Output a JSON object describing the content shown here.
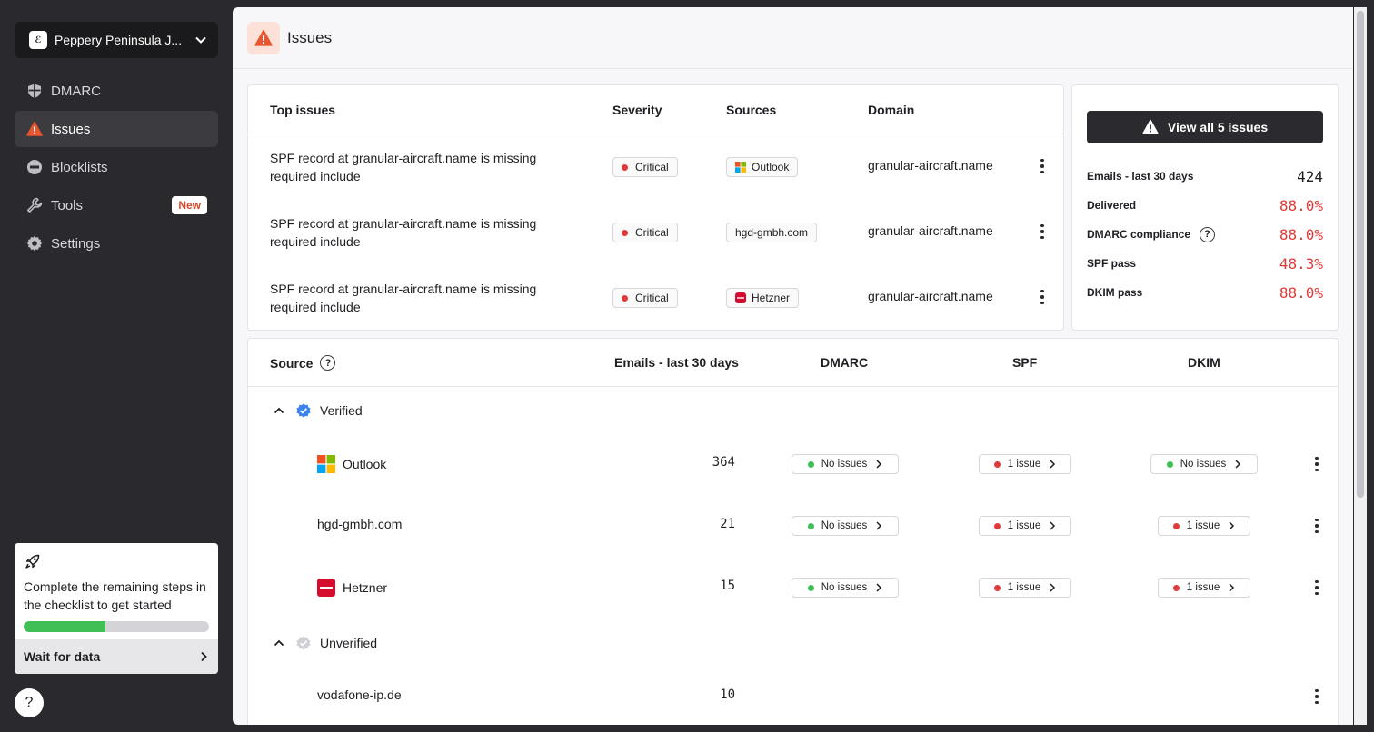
{
  "sidebar": {
    "org_name": "Peppery Peninsula J...",
    "nav": [
      {
        "label": "DMARC",
        "icon": "shield-icon"
      },
      {
        "label": "Issues",
        "icon": "warning-icon"
      },
      {
        "label": "Blocklists",
        "icon": "blocklist-icon"
      },
      {
        "label": "Tools",
        "icon": "wrench-icon",
        "badge": "New"
      },
      {
        "label": "Settings",
        "icon": "gear-icon"
      }
    ],
    "checklist": {
      "text": "Complete the remaining steps in the checklist to get started",
      "progress": 0.44,
      "action": "Wait for data"
    },
    "help": "?"
  },
  "header": {
    "title": "Issues"
  },
  "top_issues": {
    "columns": [
      "Top issues",
      "Severity",
      "Sources",
      "Domain"
    ],
    "rows": [
      {
        "title": "SPF record at granular-aircraft.name is missing required include",
        "severity": "Critical",
        "source": "Outlook",
        "source_icon": "outlook-icon",
        "domain": "granular-aircraft.name"
      },
      {
        "title": "SPF record at granular-aircraft.name is missing required include",
        "severity": "Critical",
        "source": "hgd-gmbh.com",
        "source_icon": "",
        "domain": "granular-aircraft.name"
      },
      {
        "title": "SPF record at granular-aircraft.name is missing required include",
        "severity": "Critical",
        "source": "Hetzner",
        "source_icon": "hetzner-icon",
        "domain": "granular-aircraft.name"
      }
    ]
  },
  "stats": {
    "view_all": "View all 5 issues",
    "items": [
      {
        "label": "Emails - last 30 days",
        "value": "424"
      },
      {
        "label": "Delivered",
        "value": "88.0%"
      },
      {
        "label": "DMARC compliance",
        "value": "88.0%",
        "help": "?"
      },
      {
        "label": "SPF pass",
        "value": "48.3%"
      },
      {
        "label": "DKIM pass",
        "value": "88.0%"
      }
    ]
  },
  "sources": {
    "columns": {
      "source": "Source",
      "emails": "Emails - last 30 days",
      "dmarc": "DMARC",
      "spf": "SPF",
      "dkim": "DKIM"
    },
    "source_help": "?",
    "groups": [
      {
        "label": "Verified"
      },
      {
        "label": "Unverified"
      }
    ],
    "rows": [
      {
        "name": "Outlook",
        "count": "364",
        "dmarc": "No issues",
        "spf": "1 issue",
        "dkim": "No issues"
      },
      {
        "name": "hgd-gmbh.com",
        "count": "21",
        "dmarc": "No issues",
        "spf": "1 issue",
        "dkim": "1 issue"
      },
      {
        "name": "Hetzner",
        "count": "15",
        "dmarc": "No issues",
        "spf": "1 issue",
        "dkim": "1 issue"
      },
      {
        "name": "vodafone-ip.de",
        "count": "10"
      }
    ]
  },
  "colors": {
    "accent": "#e8552f",
    "critical": "#e03b3b",
    "ok": "#3fbf55",
    "sidebar": "#2a2a2e"
  }
}
